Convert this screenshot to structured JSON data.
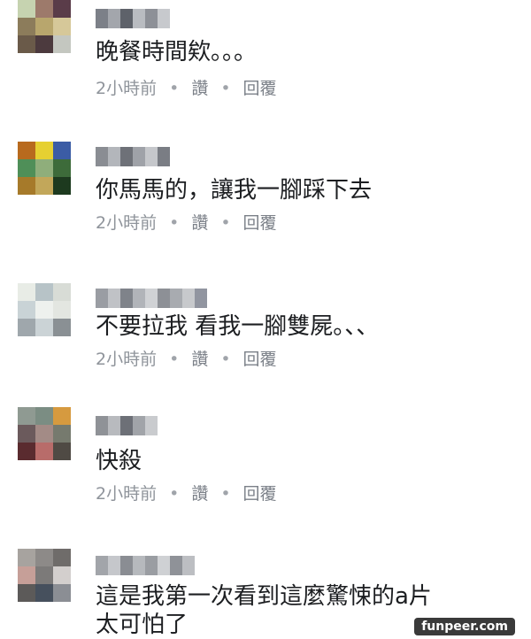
{
  "comments": [
    {
      "text": "晚餐時間欸。。。",
      "time": "2小時前",
      "like_label": "讚",
      "reply_label": "回覆",
      "avatar_colors": [
        "#c6d3b0",
        "#9d7a6b",
        "#5a3c49",
        "#8c7c5b",
        "#b8a66d",
        "#d6c899",
        "#6a5a49",
        "#4c3a3e",
        "#c4c7c0"
      ],
      "name_colors": [
        "#7c8088",
        "#a3a6ac",
        "#5e626a",
        "#b9bcc1",
        "#8d9097",
        "#c7c9cd"
      ]
    },
    {
      "text": "你馬馬的，讓我一腳踩下去",
      "time": "2小時前",
      "like_label": "讚",
      "reply_label": "回覆",
      "avatar_colors": [
        "#b86a1e",
        "#e6d032",
        "#3b5ca5",
        "#4f8f58",
        "#8fae7b",
        "#3d6b3a",
        "#a67a2a",
        "#c2a75a",
        "#1d3a1f"
      ],
      "name_colors": [
        "#8a8d93",
        "#b3b6bb",
        "#6e7178",
        "#9fa2a8",
        "#c5c7cb",
        "#7a7d84"
      ]
    },
    {
      "text": "不要拉我 看我一腳雙屍。、、",
      "time": "2小時前",
      "like_label": "讚",
      "reply_label": "回覆",
      "avatar_colors": [
        "#e8ece6",
        "#b7c3c7",
        "#d8dcd6",
        "#c9d3d6",
        "#eef1ee",
        "#e3e6e1",
        "#9fa7ac",
        "#cbd3d6",
        "#8a9094"
      ],
      "name_colors": [
        "#9a9da3",
        "#c0c2c6",
        "#7f838a",
        "#b1b4b9",
        "#d0d2d5",
        "#8d9096",
        "#a8abb0",
        "#c7c9cc",
        "#9195a0"
      ]
    },
    {
      "text": "快殺",
      "time": "2小時前",
      "like_label": "讚",
      "reply_label": "回覆",
      "avatar_colors": [
        "#8f9a92",
        "#7b8d83",
        "#d69a3f",
        "#6b5a5c",
        "#a38b86",
        "#767a6e",
        "#5a2b2f",
        "#b86c6a",
        "#4f4a44"
      ],
      "name_colors": [
        "#8f9297",
        "#b8babe",
        "#6d7077",
        "#a1a4a9",
        "#c9cbce"
      ]
    },
    {
      "text": "這是我第一次看到這麼驚悚的a片\n太可怕了",
      "avatar_colors": [
        "#a7a39f",
        "#8d8a88",
        "#6f6c6a",
        "#c69f98",
        "#7c7a79",
        "#d3cfcd",
        "#5c5a59",
        "#46505d",
        "#8b8e94"
      ],
      "name_colors": [
        "#a2a5aa",
        "#c5c7cb",
        "#8a8d93",
        "#b6b9bd",
        "#9a9da2",
        "#cfd1d4",
        "#8f9298",
        "#bcbec2"
      ]
    }
  ],
  "watermark": "funpeer.com"
}
